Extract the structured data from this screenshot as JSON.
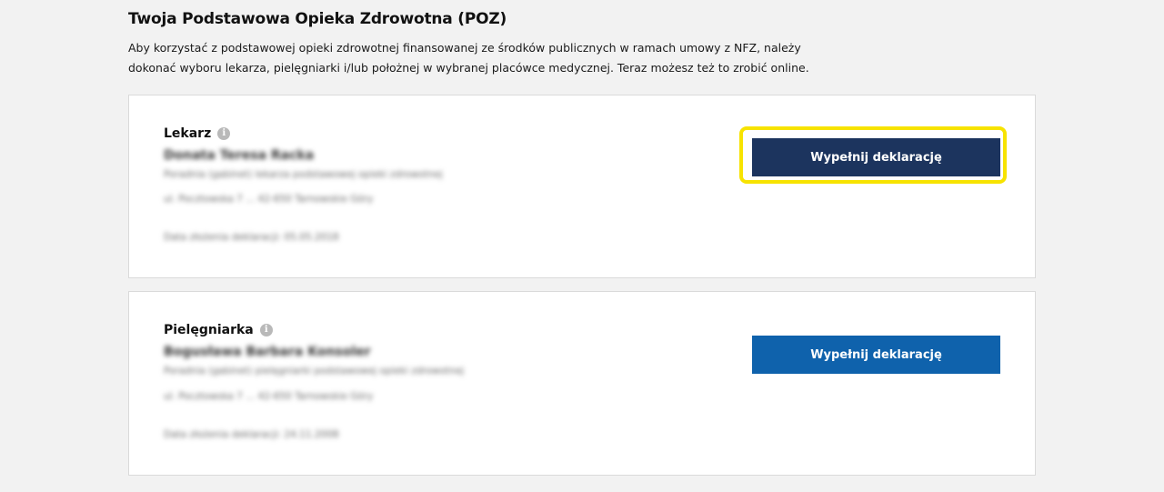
{
  "section": {
    "title": "Twoja Podstawowa Opieka Zdrowotna (POZ)",
    "intro": "Aby korzystać z podstawowej opieki zdrowotnej finansowanej ze środków publicznych w ramach umowy z NFZ, należy dokonać wyboru lekarza, pielęgniarki i/lub położnej w wybranej placówce medycznej. Teraz możesz też to zrobić online."
  },
  "cards": {
    "doctor": {
      "role": "Lekarz",
      "info_icon": "info-icon",
      "name_redacted": "Donata Teresa Racka",
      "type_redacted": "Poradnia (gabinet) lekarza podstawowej opieki zdrowotnej",
      "address_redacted": "ul. Pocztowska 7 ... 42-650 Tarnowskie Góry",
      "date_redacted": "Data złożenia deklaracji: 05.05.2018",
      "button_label": "Wypełnij deklarację",
      "button_color": "#1c345e",
      "highlighted": true,
      "highlight_color": "#f7e300"
    },
    "nurse": {
      "role": "Pielęgniarka",
      "info_icon": "info-icon",
      "name_redacted": "Bogusława Barbara Konsoler",
      "type_redacted": "Poradnia (gabinet) pielęgniarki podstawowej opieki zdrowotnej",
      "address_redacted": "ul. Pocztowska 7 ... 42-650 Tarnowskie Góry",
      "date_redacted": "Data złożenia deklaracji: 24.11.2008",
      "button_label": "Wypełnij deklarację",
      "button_color": "#0f62ac"
    }
  }
}
